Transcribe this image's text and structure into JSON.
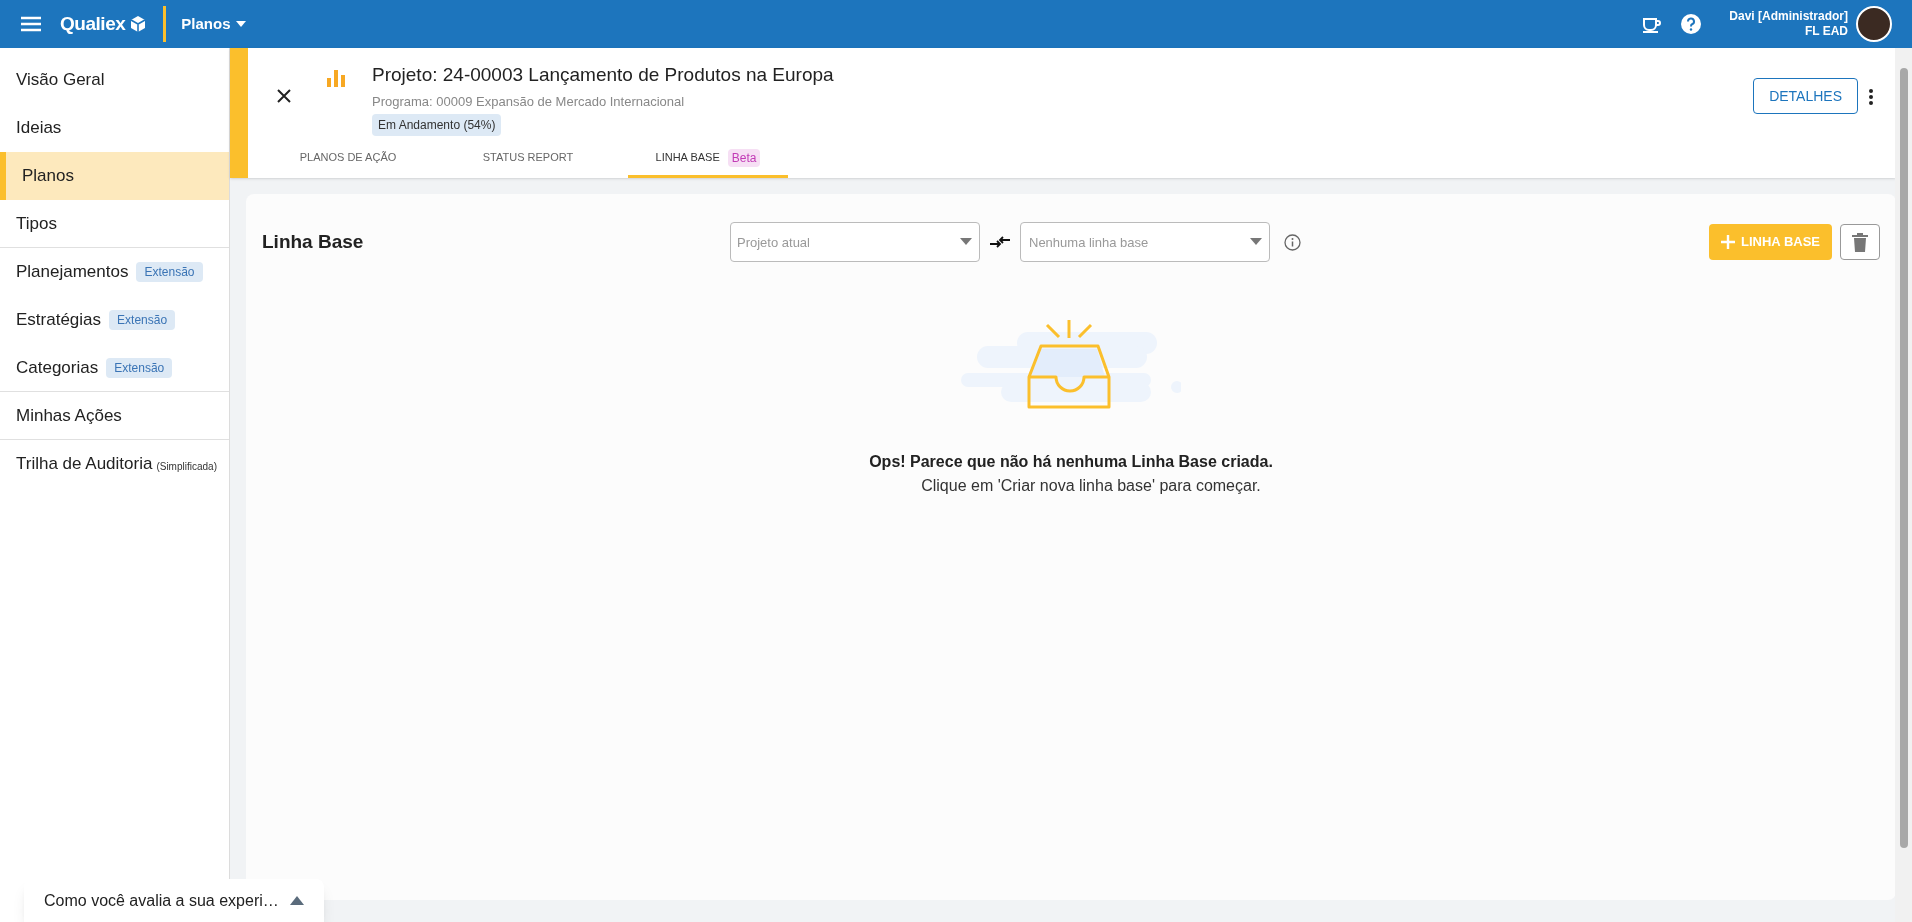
{
  "topbar": {
    "logo": "Qualiex",
    "module": "Planos",
    "user_name": "Davi [Administrador]",
    "user_unit": "FL EAD"
  },
  "sidebar": {
    "items": [
      {
        "label": "Visão Geral",
        "selected": false,
        "divider_after": false
      },
      {
        "label": "Ideias",
        "selected": false,
        "divider_after": false
      },
      {
        "label": "Planos",
        "selected": true,
        "divider_after": false
      },
      {
        "label": "Tipos",
        "selected": false,
        "divider_after": true
      },
      {
        "label": "Planejamentos",
        "badge": "Extensão",
        "selected": false,
        "divider_after": false
      },
      {
        "label": "Estratégias",
        "badge": "Extensão",
        "selected": false,
        "divider_after": false
      },
      {
        "label": "Categorias",
        "badge": "Extensão",
        "selected": false,
        "divider_after": true
      },
      {
        "label": "Minhas Ações",
        "selected": false,
        "divider_after": true
      },
      {
        "label": "Trilha de Auditoria",
        "note": "(Simplificada)",
        "selected": false,
        "divider_after": false
      }
    ]
  },
  "project": {
    "title": "Projeto: 24-00003 Lançamento de Produtos na Europa",
    "program": "Programa: 00009 Expansão de Mercado Internacional",
    "status": "Em Andamento (54%)",
    "details_button": "DETALHES",
    "tabs": [
      {
        "label": "PLANOS DE AÇÃO",
        "selected": false
      },
      {
        "label": "STATUS REPORT",
        "selected": false
      },
      {
        "label": "LINHA BASE",
        "badge": "Beta",
        "selected": true
      }
    ]
  },
  "baseline": {
    "title": "Linha Base",
    "current_select": {
      "placeholder": "Projeto atual"
    },
    "compare_select": {
      "placeholder": "Nenhuma linha base"
    },
    "add_button": "LINHA BASE",
    "empty_title": "Ops! Parece que não há nenhuma Linha Base criada.",
    "empty_hint": "Clique em 'Criar nova linha base' para começar."
  },
  "feedback": {
    "text": "Como você avalia a sua experi…"
  }
}
